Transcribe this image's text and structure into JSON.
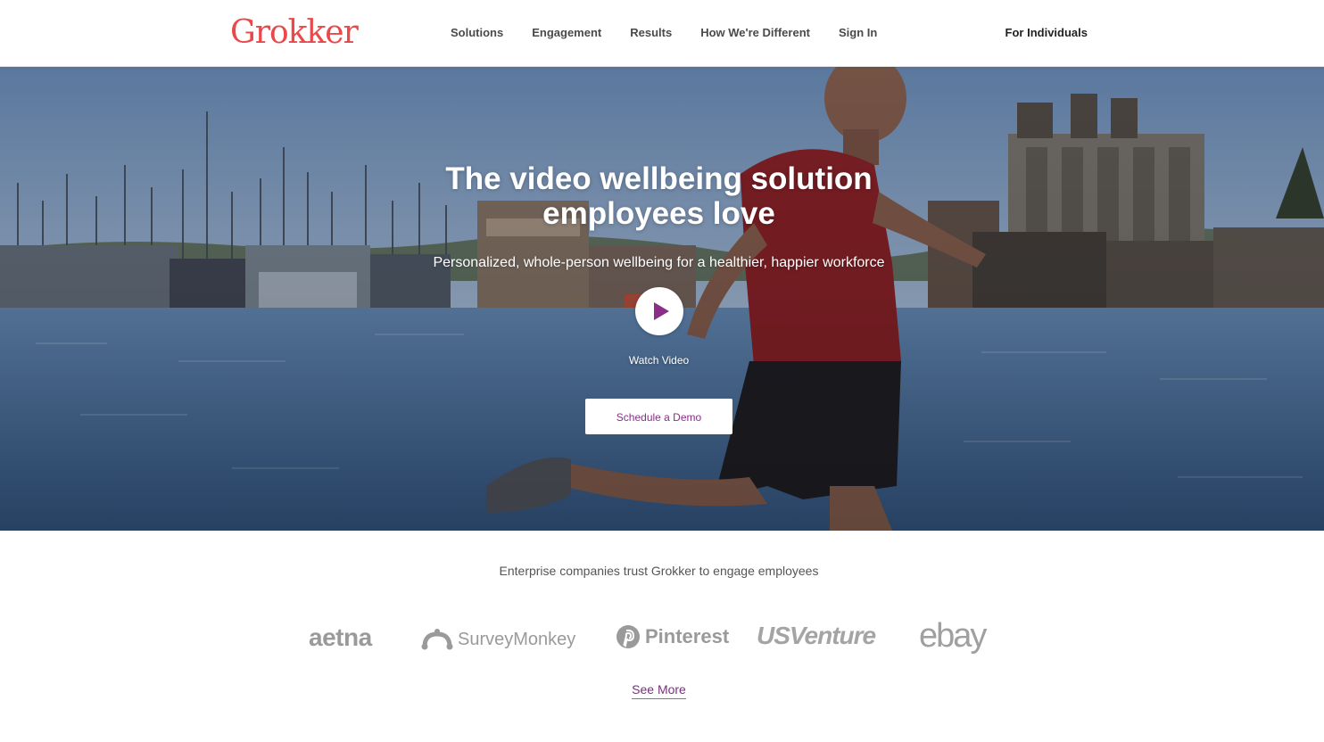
{
  "header": {
    "logo": "Grokker",
    "nav": [
      "Solutions",
      "Engagement",
      "Results",
      "How We're Different",
      "Sign In"
    ],
    "right_link": "For Individuals"
  },
  "hero": {
    "title": "The video wellbeing solution\nemployees love",
    "subtitle": "Personalized, whole-person wellbeing for a healthier, happier workforce",
    "watch_label": "Watch Video",
    "cta_label": "Schedule a Demo",
    "play_icon": "play-icon"
  },
  "trust": {
    "text": "Enterprise companies trust Grokker to engage employees",
    "brands": [
      "aetna",
      "SurveyMonkey",
      "Pinterest",
      "USVenture",
      "ebay"
    ],
    "see_more": "See More"
  },
  "colors": {
    "brand": "#e8494a",
    "accent": "#8a2f87",
    "nav_text": "#4a4a4a",
    "logo_gray": "#9a9a9a"
  }
}
